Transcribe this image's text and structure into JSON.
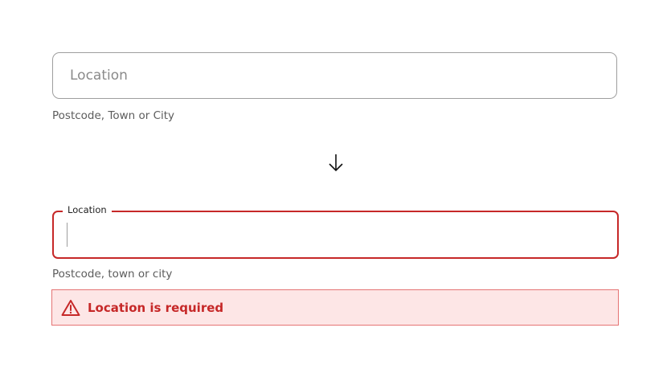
{
  "default_field": {
    "placeholder": "Location",
    "hint": "Postcode, Town or City"
  },
  "arrow_icon": "arrow-down-icon",
  "error_field": {
    "label": "Location",
    "hint": "Postcode, town or city",
    "error_message": "Location is required",
    "error_icon": "warning-triangle-icon",
    "error_color": "#c62828",
    "error_bg": "#fde6e6"
  }
}
